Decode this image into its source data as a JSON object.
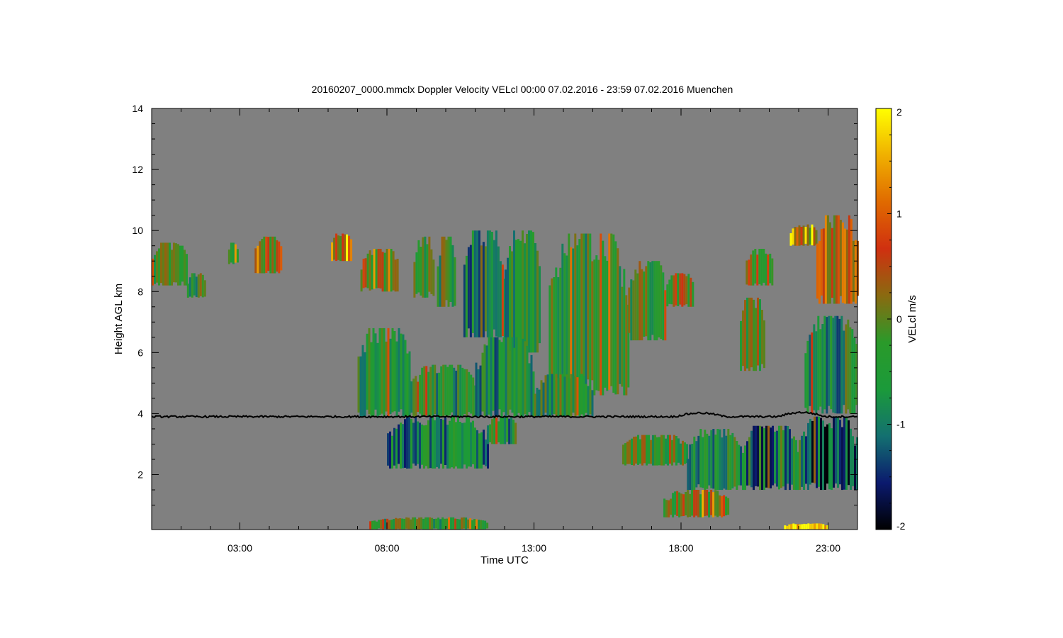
{
  "chart_data": {
    "type": "heatmap",
    "title": "20160207_0000.mmclx Doppler Velocity VELcl   00:00 07.02.2016 - 23:59 07.02.2016 Muenchen",
    "xlabel": "Time UTC",
    "ylabel": "Height AGL km",
    "colorbar_label": "VELcl m/s",
    "x_range_hours": [
      0,
      24
    ],
    "y_range_km": [
      0.2,
      14
    ],
    "x_ticks": [
      {
        "value": 3,
        "label": "03:00"
      },
      {
        "value": 8,
        "label": "08:00"
      },
      {
        "value": 13,
        "label": "13:00"
      },
      {
        "value": 18,
        "label": "18:00"
      },
      {
        "value": 23,
        "label": "23:00"
      }
    ],
    "y_ticks": [
      {
        "value": 2,
        "label": "2"
      },
      {
        "value": 4,
        "label": "4"
      },
      {
        "value": 6,
        "label": "6"
      },
      {
        "value": 8,
        "label": "8"
      },
      {
        "value": 10,
        "label": "10"
      },
      {
        "value": 12,
        "label": "12"
      },
      {
        "value": 14,
        "label": "14"
      }
    ],
    "colorbar_range": [
      -2,
      2
    ],
    "colorbar_ticks": [
      {
        "value": 2,
        "label": "2"
      },
      {
        "value": 1,
        "label": "1"
      },
      {
        "value": 0,
        "label": "0"
      },
      {
        "value": -1,
        "label": "-1"
      },
      {
        "value": -2,
        "label": "-2"
      }
    ],
    "colors": {
      "no_signal": "#808080",
      "colormap": [
        "#000000",
        "#0b1a6e",
        "#137070",
        "#1b9a3a",
        "#2a9a2a",
        "#8a6a10",
        "#d03010",
        "#e06a00",
        "#f0b000",
        "#ffff00"
      ]
    },
    "reference_line_km": 3.9,
    "echo_regions": [
      {
        "t": [
          0.0,
          1.2
        ],
        "z": [
          8.2,
          9.6
        ],
        "v": -0.3
      },
      {
        "t": [
          1.2,
          1.8
        ],
        "z": [
          7.8,
          8.6
        ],
        "v": -0.4
      },
      {
        "t": [
          2.6,
          2.9
        ],
        "z": [
          8.9,
          9.6
        ],
        "v": 0.0
      },
      {
        "t": [
          3.5,
          4.4
        ],
        "z": [
          8.6,
          9.8
        ],
        "v": 0.2
      },
      {
        "t": [
          6.1,
          6.8
        ],
        "z": [
          9.0,
          9.9
        ],
        "v": 0.4
      },
      {
        "t": [
          7.1,
          8.4
        ],
        "z": [
          8.0,
          9.4
        ],
        "v": 0.1
      },
      {
        "t": [
          8.9,
          9.6
        ],
        "z": [
          7.8,
          9.8
        ],
        "v": -0.2
      },
      {
        "t": [
          9.7,
          10.3
        ],
        "z": [
          7.5,
          9.8
        ],
        "v": -0.4
      },
      {
        "t": [
          10.6,
          12.0
        ],
        "z": [
          6.5,
          10.0
        ],
        "v": -0.8
      },
      {
        "t": [
          12.0,
          13.2
        ],
        "z": [
          6.0,
          10.0
        ],
        "v": -0.7
      },
      {
        "t": [
          13.5,
          16.2
        ],
        "z": [
          4.6,
          9.9
        ],
        "v": -0.4
      },
      {
        "t": [
          16.2,
          17.5
        ],
        "z": [
          6.4,
          9.0
        ],
        "v": -0.3
      },
      {
        "t": [
          17.5,
          18.4
        ],
        "z": [
          7.5,
          8.6
        ],
        "v": 0.2
      },
      {
        "t": [
          7.0,
          8.8
        ],
        "z": [
          3.9,
          6.8
        ],
        "v": -0.5
      },
      {
        "t": [
          8.8,
          11.0
        ],
        "z": [
          3.9,
          5.6
        ],
        "v": -0.6
      },
      {
        "t": [
          11.0,
          13.0
        ],
        "z": [
          3.9,
          6.5
        ],
        "v": -0.7
      },
      {
        "t": [
          13.0,
          15.0
        ],
        "z": [
          3.9,
          5.3
        ],
        "v": -0.5
      },
      {
        "t": [
          8.0,
          11.4
        ],
        "z": [
          2.2,
          3.9
        ],
        "v": -0.9
      },
      {
        "t": [
          11.4,
          12.4
        ],
        "z": [
          3.0,
          3.9
        ],
        "v": -0.7
      },
      {
        "t": [
          20.2,
          21.1
        ],
        "z": [
          8.2,
          9.4
        ],
        "v": 0.1
      },
      {
        "t": [
          20.0,
          20.8
        ],
        "z": [
          5.4,
          7.8
        ],
        "v": -0.2
      },
      {
        "t": [
          21.7,
          22.6
        ],
        "z": [
          9.5,
          10.2
        ],
        "v": 0.5
      },
      {
        "t": [
          22.6,
          24.0
        ],
        "z": [
          7.6,
          10.5
        ],
        "v": 0.6
      },
      {
        "t": [
          22.2,
          24.0
        ],
        "z": [
          4.0,
          7.2
        ],
        "v": -0.7
      },
      {
        "t": [
          16.0,
          18.2
        ],
        "z": [
          2.3,
          3.3
        ],
        "v": -0.2
      },
      {
        "t": [
          18.2,
          20.0
        ],
        "z": [
          1.5,
          3.5
        ],
        "v": -0.6
      },
      {
        "t": [
          20.0,
          22.0
        ],
        "z": [
          1.5,
          3.6
        ],
        "v": -1.1
      },
      {
        "t": [
          22.0,
          24.0
        ],
        "z": [
          1.5,
          3.9
        ],
        "v": -1.3
      },
      {
        "t": [
          17.4,
          19.6
        ],
        "z": [
          0.6,
          1.5
        ],
        "v": -0.1
      },
      {
        "t": [
          7.4,
          11.4
        ],
        "z": [
          0.2,
          0.6
        ],
        "v": -0.4
      },
      {
        "t": [
          21.5,
          23.0
        ],
        "z": [
          0.2,
          0.4
        ],
        "v": 1.9
      }
    ]
  }
}
